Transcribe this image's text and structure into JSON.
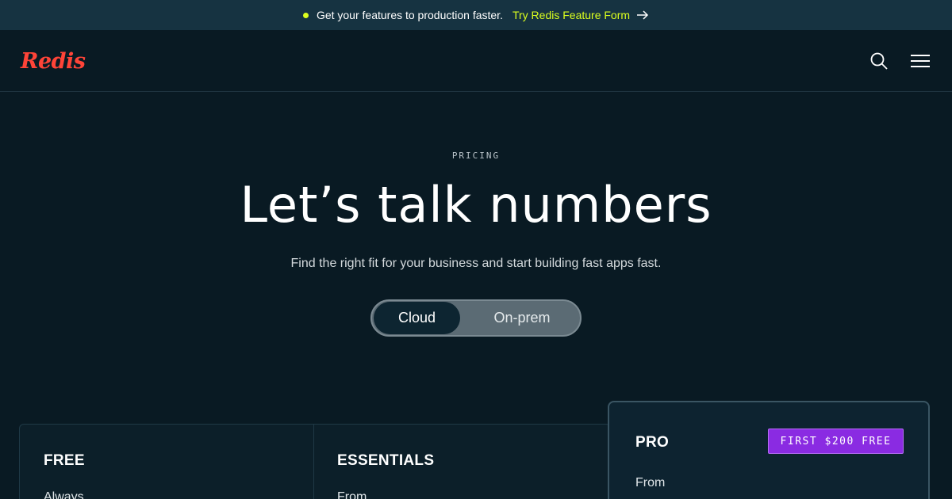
{
  "announcement": {
    "text": "Get your features to production faster.",
    "cta_label": "Try Redis Feature Form",
    "dot_color": "#dcff1e"
  },
  "header": {
    "logo_text": "Redis",
    "logo_color": "#ff4438",
    "icons": [
      "search-icon",
      "menu-icon"
    ]
  },
  "hero": {
    "eyebrow": "PRICING",
    "title": "Let’s talk numbers",
    "subtitle": "Find the right fit for your business and start building fast apps fast."
  },
  "toggle": {
    "options": [
      "Cloud",
      "On-prem"
    ],
    "selected": "Cloud"
  },
  "plans": [
    {
      "name": "FREE",
      "price_prefix": "Always"
    },
    {
      "name": "ESSENTIALS",
      "price_prefix": "From"
    },
    {
      "name": "PRO",
      "price_prefix": "From",
      "badge": "FIRST $200 FREE"
    }
  ],
  "colors": {
    "background": "#091a23",
    "announcement_bg": "#163341",
    "badge_bg": "#8a2be2"
  }
}
